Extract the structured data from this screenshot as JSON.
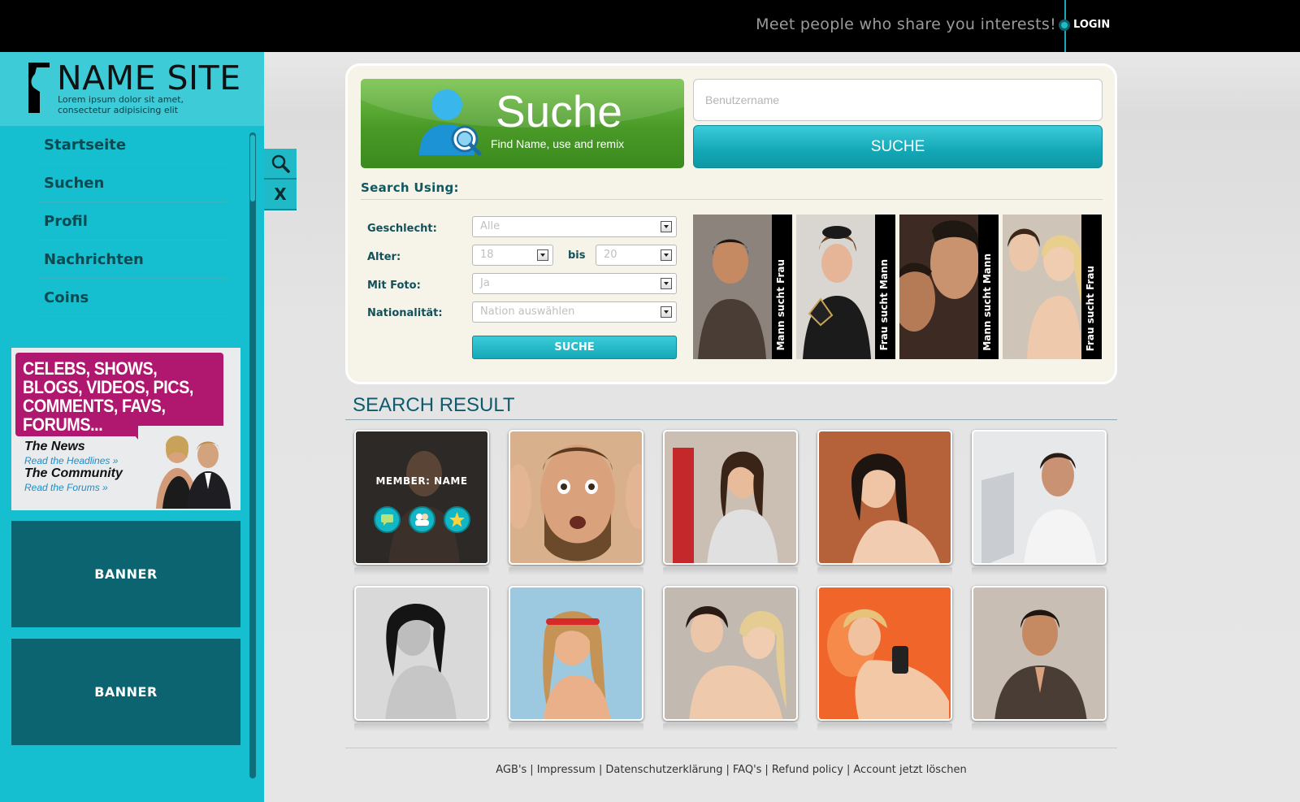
{
  "header": {
    "tagline": "Meet people who share you interests!",
    "login_label": "LOGIN"
  },
  "brand": {
    "title": "NAME SITE",
    "subtitle": "Lorem ipsum dolor sit amet, consectetur adipisicing elit"
  },
  "nav": {
    "items": [
      {
        "label": "Startseite"
      },
      {
        "label": "Suchen"
      },
      {
        "label": "Profil"
      },
      {
        "label": "Nachrichten"
      },
      {
        "label": "Coins"
      }
    ]
  },
  "ad": {
    "headline": "CELEBS, SHOWS, BLOGS, VIDEOS, PICS, COMMENTS, FAVS, FORUMS...",
    "news_title": "The News",
    "news_link": "Read the Headlines »",
    "community_title": "The Community",
    "community_link": "Read the Forums »"
  },
  "banners": [
    "BANNER",
    "BANNER"
  ],
  "side_tools": {
    "close_label": "X"
  },
  "search": {
    "title": "Suche",
    "subtitle": "Find Name, use and remix",
    "username_placeholder": "Benutzername",
    "button_label": "SUCHE",
    "using_label": "Search Using:",
    "fields": {
      "gender_label": "Geschlecht:",
      "gender_value": "Alle",
      "age_label": "Alter:",
      "age_from": "18",
      "age_to_label": "bis",
      "age_to": "20",
      "photo_label": "Mit Foto:",
      "photo_value": "Ja",
      "nationality_label": "Nationalität:",
      "nationality_value": "Nation auswählen"
    },
    "submit_label": "SUCHE",
    "categories": [
      {
        "label": "Mann sucht Frau"
      },
      {
        "label": "Frau sucht Mann"
      },
      {
        "label": "Mann sucht Mann"
      },
      {
        "label": "Frau sucht Frau"
      }
    ]
  },
  "results": {
    "title": "SEARCH RESULT",
    "member_label": "MEMBER: NAME"
  },
  "footer": {
    "links": [
      "AGB's",
      "Impressum",
      "Datenschutzerklärung",
      "FAQ's",
      "Refund policy",
      "Account jetzt löschen"
    ],
    "separator": "|"
  },
  "colors": {
    "accent": "#15bfcf",
    "accent_dark": "#0b6470",
    "green": "#4a9a28",
    "panel_bg": "#f6f3e8"
  }
}
